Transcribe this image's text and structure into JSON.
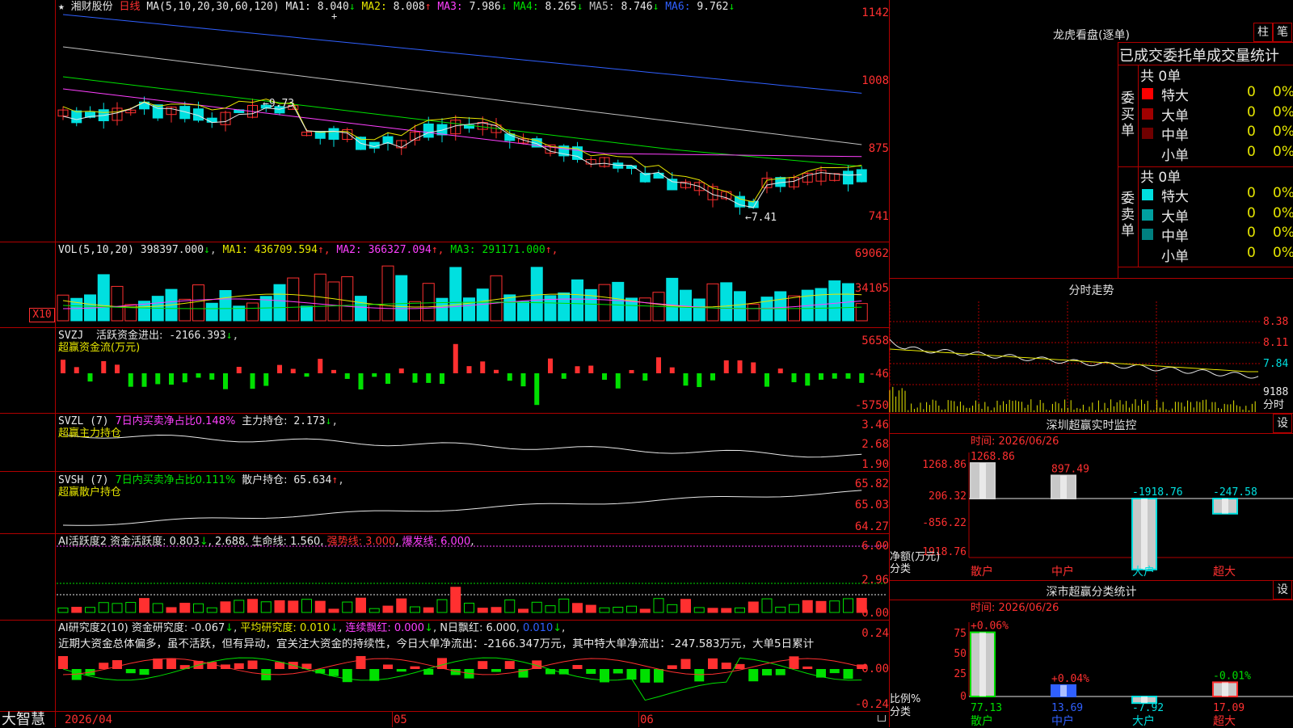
{
  "main": {
    "star": "★",
    "stock_name": "湘财股份",
    "period": "日线",
    "ma_spec": "MA(5,10,20,30,60,120)",
    "ma": [
      {
        "label": "MA1:",
        "value": "8.040",
        "dir": "↓",
        "color": "#e8e8e8"
      },
      {
        "label": "MA2:",
        "value": "8.008",
        "dir": "↑",
        "color": "#e6e600"
      },
      {
        "label": "MA3:",
        "value": "7.986",
        "dir": "↓",
        "color": "#ff40ff"
      },
      {
        "label": "MA4:",
        "value": "8.265",
        "dir": "↓",
        "color": "#00e000"
      },
      {
        "label": "MA5:",
        "value": "8.746",
        "dir": "↓",
        "color": "#c0c0c0"
      },
      {
        "label": "MA6:",
        "value": "9.762",
        "dir": "↓",
        "color": "#3060ff"
      }
    ],
    "y_labels": [
      "1142",
      "1008",
      "875",
      "741"
    ],
    "high_mark": "9.73",
    "low_mark": "7.41"
  },
  "vol": {
    "label": "VOL(5,10,20)",
    "value": "398397.000",
    "ma": [
      {
        "label": "MA1:",
        "value": "436709.594",
        "dir": "↑",
        "color": "#e6e600"
      },
      {
        "label": "MA2:",
        "value": "366327.094",
        "dir": "↑",
        "color": "#ff40ff"
      },
      {
        "label": "MA3:",
        "value": "291171.000",
        "dir": "↑",
        "color": "#00e000"
      }
    ],
    "y_labels": [
      "69062",
      "34105"
    ],
    "unit": "X10"
  },
  "svzj": {
    "label": "SVZJ",
    "item": "活跃资金进出:",
    "value": "-2166.393",
    "dir": "↓",
    "subtitle": "超赢资金流(万元)",
    "y_labels": [
      "5658",
      "-46",
      "-5750"
    ]
  },
  "svzl": {
    "label": "SVZL (7)",
    "item1": "7日内买卖净占比0.148%",
    "item2": "主力持仓:",
    "value": "2.173",
    "dir": "↓",
    "subtitle": "超赢主力持仓",
    "y_labels": [
      "3.46",
      "2.68",
      "1.90"
    ]
  },
  "svsh": {
    "label": "SVSH (7)",
    "item1": "7日内买卖净占比0.111%",
    "item2": "散户持仓:",
    "value": "65.634",
    "dir": "↑",
    "subtitle": "超赢散户持仓",
    "y_labels": [
      "65.82",
      "65.03",
      "64.27"
    ]
  },
  "ai_act": {
    "label": "AI活跃度2",
    "items": [
      {
        "text": "资金活跃度: 0.803",
        "dir": "↓",
        "color": "#e8e8e8"
      },
      {
        "text": "2.688",
        "dir": "",
        "color": "#e8e8e8"
      },
      {
        "text": "生命线: 1.560",
        "dir": "",
        "color": "#e8e8e8"
      },
      {
        "text": "强势线: 3.000",
        "dir": "",
        "color": "#ff3030"
      },
      {
        "text": "爆发线: 6.000",
        "dir": "",
        "color": "#ff40ff"
      }
    ],
    "y_labels": [
      "6.00",
      "2.96",
      "0.00"
    ]
  },
  "ai_res": {
    "label": "AI研究度2(10)",
    "items": [
      {
        "text": "资金研究度: -0.067",
        "dir": "↓",
        "color": "#e8e8e8"
      },
      {
        "text": "平均研究度: 0.010",
        "dir": "↓",
        "color": "#e6e600"
      },
      {
        "text": "连续飘红: 0.000",
        "dir": "↓",
        "color": "#ff40ff"
      },
      {
        "text": "N日飘红: 6.000",
        "dir": "",
        "color": "#e8e8e8"
      },
      {
        "text": "0.010",
        "dir": "↓",
        "color": "#3060ff"
      }
    ],
    "comment": "近期大资金总体偏多，虽不活跃，但有异动，宜关注大资金的持续性，今日大单净流出：-2166.347万元，其中特大单净流出：-247.583万元，大单5日累计",
    "y_labels": [
      "0.24",
      "0.00",
      "-0.24"
    ]
  },
  "bottom": {
    "brand": "大智慧",
    "dates": [
      "2026/04",
      "05",
      "06"
    ]
  },
  "lhb": {
    "title": "龙虎看盘(逐单)",
    "btn1": "柱",
    "btn2": "笔",
    "subtitle": "已成交委托单成交量统计",
    "buy": {
      "side": "委买单",
      "total": "共 0单",
      "rows": [
        {
          "name": "特大",
          "count": "0",
          "pct": "0%",
          "color": "#ff0000"
        },
        {
          "name": "大单",
          "count": "0",
          "pct": "0%",
          "color": "#a00000"
        },
        {
          "name": "中单",
          "count": "0",
          "pct": "0%",
          "color": "#700000"
        },
        {
          "name": "小单",
          "count": "0",
          "pct": "0%",
          "color": ""
        }
      ]
    },
    "sell": {
      "side": "委卖单",
      "total": "共 0单",
      "rows": [
        {
          "name": "特大",
          "count": "0",
          "pct": "0%",
          "color": "#00e0e0"
        },
        {
          "name": "大单",
          "count": "0",
          "pct": "0%",
          "color": "#00a0a0"
        },
        {
          "name": "中单",
          "count": "0",
          "pct": "0%",
          "color": "#008080"
        },
        {
          "name": "小单",
          "count": "0",
          "pct": "0%",
          "color": ""
        }
      ]
    }
  },
  "intraday": {
    "title": "分时走势",
    "prices": [
      "8.38",
      "8.11",
      "7.84"
    ],
    "volume": "9188",
    "unit": "分时"
  },
  "monitor": {
    "title": "深圳超赢实时监控",
    "settings": "设",
    "time": "时间: 2026/06/26",
    "y_labels": [
      "1268.86",
      "206.32",
      "-856.22",
      "-1918.76"
    ],
    "axis_title": "净额(万元)",
    "axis_sub": "分类",
    "chart_data": {
      "type": "bar",
      "categories": [
        "散户",
        "中户",
        "大户",
        "超大"
      ],
      "values": [
        1268.86,
        897.49,
        -1918.76,
        -247.58
      ],
      "value_labels": [
        "1268.86",
        "897.49",
        "-1918.76",
        "-247.58"
      ],
      "ylim": [
        -1918.76,
        1268.86
      ]
    }
  },
  "stat": {
    "title": "深市超赢分类统计",
    "settings": "设",
    "time": "时间: 2026/06/26",
    "y_labels": [
      "75",
      "50",
      "25",
      "0"
    ],
    "axis_title": "比例%",
    "axis_sub": "分类",
    "chart_data": {
      "type": "bar",
      "categories": [
        "散户",
        "中户",
        "大户",
        "超大"
      ],
      "values": [
        77.13,
        13.69,
        -7.92,
        17.09
      ],
      "value_labels": [
        "77.13",
        "13.69",
        "-7.92",
        "17.09"
      ],
      "changes": [
        "+0.06%",
        "+0.04%",
        "",
        "-0.01%"
      ],
      "ylim": [
        0,
        80
      ]
    }
  }
}
